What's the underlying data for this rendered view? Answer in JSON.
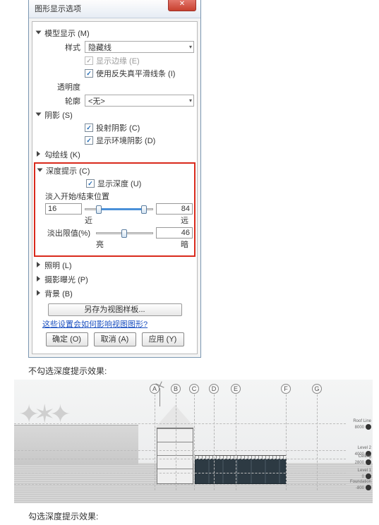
{
  "dialog": {
    "title": "图形显示选项",
    "sections": {
      "model_display": {
        "header": "模型显示 (M)",
        "style_label": "样式",
        "style_value": "隐藏线",
        "show_edges": {
          "label": "显示边缘 (E)",
          "checked": true,
          "enabled": false
        },
        "anti_alias": {
          "label": "使用反失真平滑线条 (I)",
          "checked": true,
          "enabled": true
        },
        "transparency_label": "透明度",
        "silhouette_label": "轮廓",
        "silhouette_value": "<无>"
      },
      "shadows": {
        "header": "阴影 (S)",
        "cast": {
          "label": "投射阴影 (C)",
          "checked": true
        },
        "ambient": {
          "label": "显示环境阴影 (D)",
          "checked": true
        }
      },
      "sketchy": {
        "header": "勾绘线 (K)"
      },
      "depth_cue": {
        "header": "深度提示 (C)",
        "show_depth": {
          "label": "显示深度 (U)",
          "checked": true
        },
        "fade_pos_label": "淡入开始/结束位置",
        "fade_start": 16,
        "fade_end": 84,
        "near_label": "近",
        "far_label": "远",
        "fade_limit_label": "淡出限值(%)",
        "fade_limit": 46,
        "light_label": "亮",
        "dark_label": "暗"
      },
      "lighting": {
        "header": "照明 (L)"
      },
      "exposure": {
        "header": "摄影曝光 (P)"
      },
      "background": {
        "header": "背景 (B)"
      }
    },
    "save_template": "另存为视图样板...",
    "help_link": "这些设置会如何影响视图图形?",
    "ok": "确定 (O)",
    "cancel": "取消 (A)",
    "apply": "应用 (Y)"
  },
  "caption1": "不勾选深度提示效果:",
  "caption2": "勾选深度提示效果:",
  "grids": [
    "A",
    "B",
    "C",
    "D",
    "E",
    "F",
    "G"
  ],
  "levels": [
    {
      "name": "Roof Line",
      "elev": "8000"
    },
    {
      "name": "Level 2",
      "elev": "4000"
    },
    {
      "name": "Ceiling",
      "elev": "2800"
    },
    {
      "name": "Level 1",
      "elev": "0"
    },
    {
      "name": "Foundation",
      "elev": "-800"
    }
  ]
}
